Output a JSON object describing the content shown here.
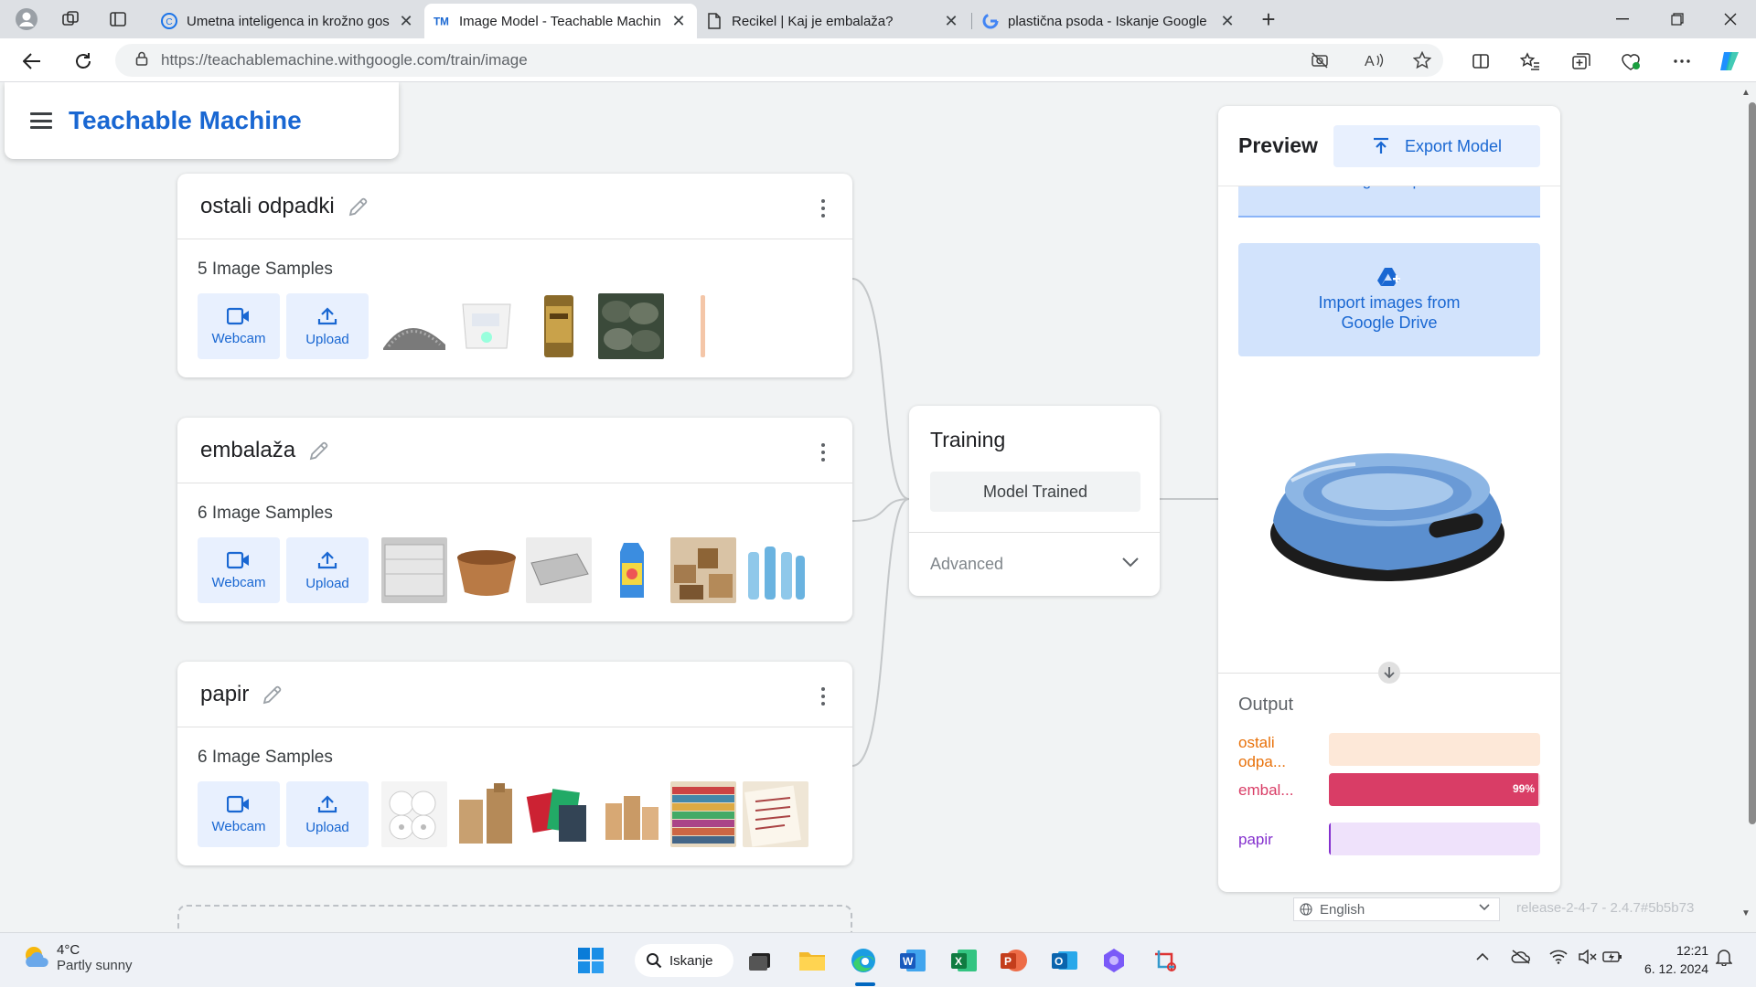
{
  "browser": {
    "tabs": [
      {
        "title": "Umetna inteligenca in krožno gos",
        "favicon": "c-icon",
        "active": false
      },
      {
        "title": "Image Model - Teachable Machin",
        "favicon": "tm-icon",
        "active": true
      },
      {
        "title": "Recikel | Kaj je embalaža?",
        "favicon": "doc-icon",
        "active": false
      },
      {
        "title": "plastična psoda - Iskanje Google",
        "favicon": "google-icon",
        "active": false
      }
    ],
    "close_glyph": "✕",
    "new_tab_glyph": "+",
    "url": "https://teachablemachine.withgoogle.com/train/image"
  },
  "app": {
    "title": "Teachable Machine",
    "accent_color": "#1967d2"
  },
  "classes": [
    {
      "name": "ostali odpadki",
      "samples_label": "5 Image Samples",
      "webcam_label": "Webcam",
      "upload_label": "Upload",
      "thumbnails": [
        "gravel",
        "diaper",
        "can",
        "tires",
        "stick"
      ]
    },
    {
      "name": "embalaža",
      "samples_label": "6 Image Samples",
      "webcam_label": "Webcam",
      "upload_label": "Upload",
      "thumbnails": [
        "plastic-tray",
        "paper-bowl",
        "foil-tray",
        "juice-carton",
        "boxes",
        "bottles"
      ]
    },
    {
      "name": "papir",
      "samples_label": "6 Image Samples",
      "webcam_label": "Webcam",
      "upload_label": "Upload",
      "thumbnails": [
        "toilet-rolls",
        "paper-bags",
        "magazines",
        "bags-small",
        "magazine-stack",
        "letters"
      ]
    }
  ],
  "training": {
    "title": "Training",
    "button_label": "Model Trained",
    "advanced_label": "Advanced"
  },
  "preview": {
    "title": "Preview",
    "export_label": "Export Model",
    "drop_text": "or drag & drop here",
    "drive_line1": "Import images from",
    "drive_line2": "Google Drive",
    "output_title": "Output",
    "outputs": [
      {
        "label_line1": "ostali",
        "label_line2": "odpa...",
        "value": 0.0,
        "percent_text": "",
        "color": "#e8710a",
        "track": "#fde8d8"
      },
      {
        "label_line1": "embal...",
        "label_line2": "",
        "value": 0.99,
        "percent_text": "99%",
        "color": "#d93d66",
        "track": "#f8d7e0"
      },
      {
        "label_line1": "papir",
        "label_line2": "",
        "value": 0.01,
        "percent_text": "",
        "color": "#8430ce",
        "track": "#efe2fb"
      }
    ]
  },
  "footer": {
    "language": "English",
    "release": "release-2-4-7 - 2.4.7#5b5b73"
  },
  "taskbar": {
    "temperature": "4°C",
    "condition": "Partly sunny",
    "search_label": "Iskanje",
    "time": "12:21",
    "date": "6. 12. 2024"
  }
}
